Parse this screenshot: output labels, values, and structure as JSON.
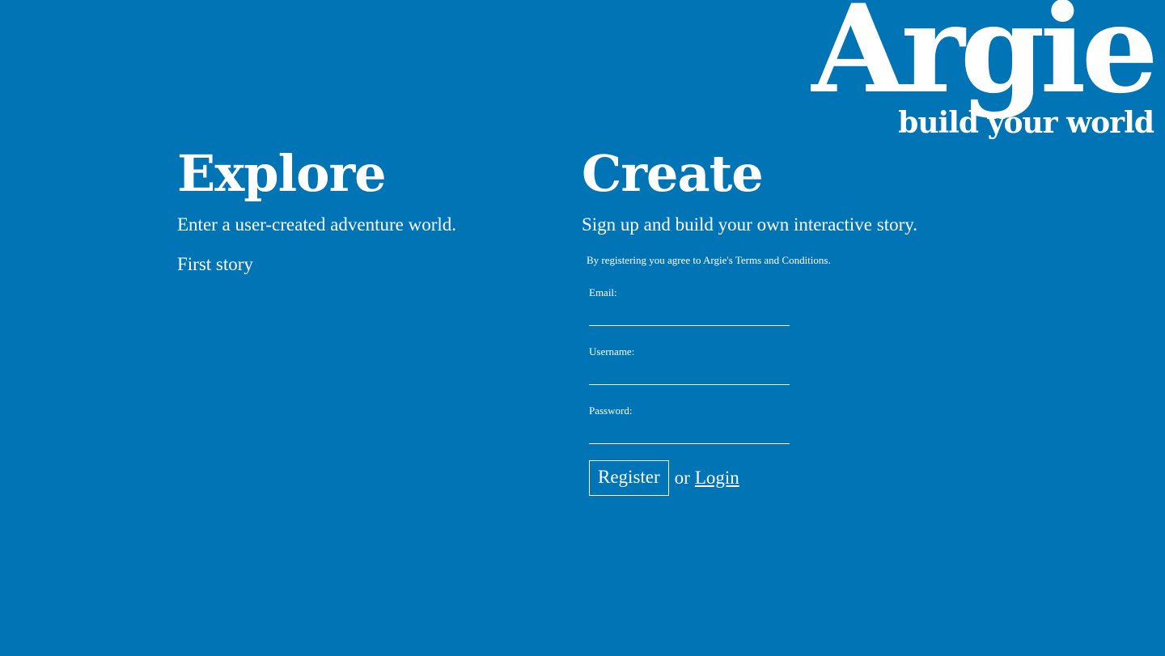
{
  "brand": {
    "title": "Argie",
    "tagline": "build your world"
  },
  "explore": {
    "heading": "Explore",
    "description": "Enter a user-created adventure world.",
    "stories": [
      "First story"
    ]
  },
  "create": {
    "heading": "Create",
    "description": "Sign up and build your own interactive story.",
    "terms": "By registering you agree to Argie's Terms and Conditions.",
    "form": {
      "email_label": "Email:",
      "email_value": "",
      "username_label": "Username:",
      "username_value": "",
      "password_label": "Password:",
      "password_value": "",
      "register_label": "Register",
      "or_text": "or",
      "login_label": "Login"
    }
  },
  "colors": {
    "background": "#0074b4",
    "text": "#ffffff"
  }
}
